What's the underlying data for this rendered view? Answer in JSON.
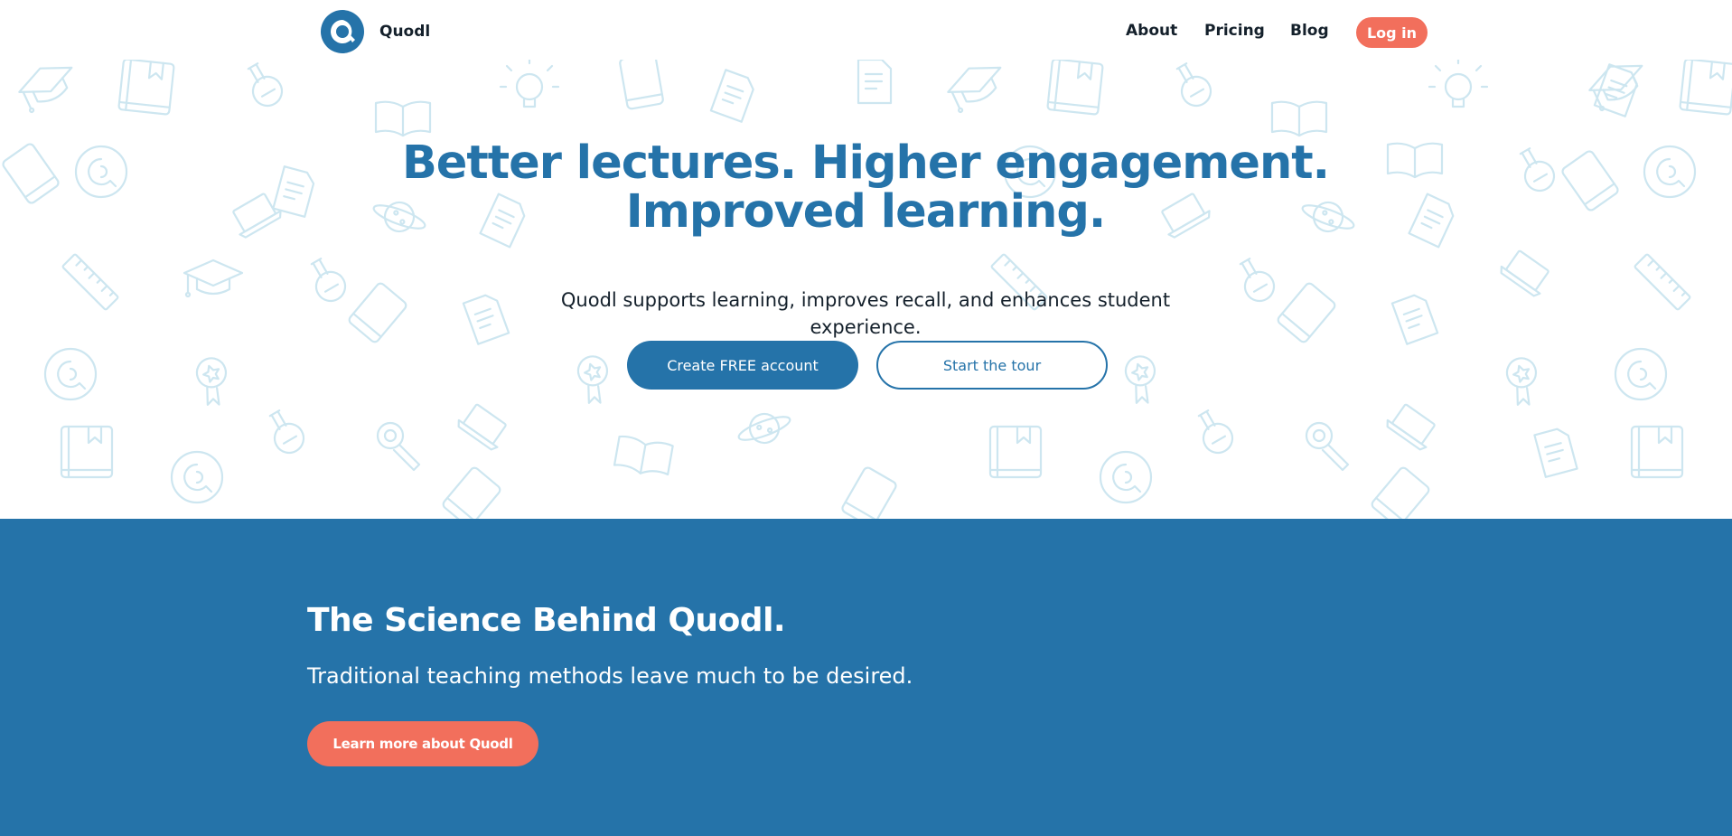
{
  "brand": {
    "name": "Quodl",
    "logo_icon": "quodl-logo-icon",
    "color": "#2573a9"
  },
  "nav": {
    "links": [
      {
        "label": "About"
      },
      {
        "label": "Pricing"
      },
      {
        "label": "Blog"
      }
    ],
    "login_label": "Log in"
  },
  "hero": {
    "title": "Better lectures. Higher engagement. Improved learning.",
    "subtitle": "Quodl supports learning, improves recall, and enhances student experience.",
    "primary_cta": "Create FREE account",
    "secondary_cta": "Start the tour",
    "background_pattern": "education-doodle-icons"
  },
  "science": {
    "title": "The Science Behind Quodl.",
    "text": "Traditional teaching methods leave much to be desired.",
    "cta": "Learn more about Quodl"
  },
  "colors": {
    "primary": "#2573a9",
    "accent": "#f26f5c",
    "text": "#14202b",
    "pattern": "#cde6f0"
  }
}
